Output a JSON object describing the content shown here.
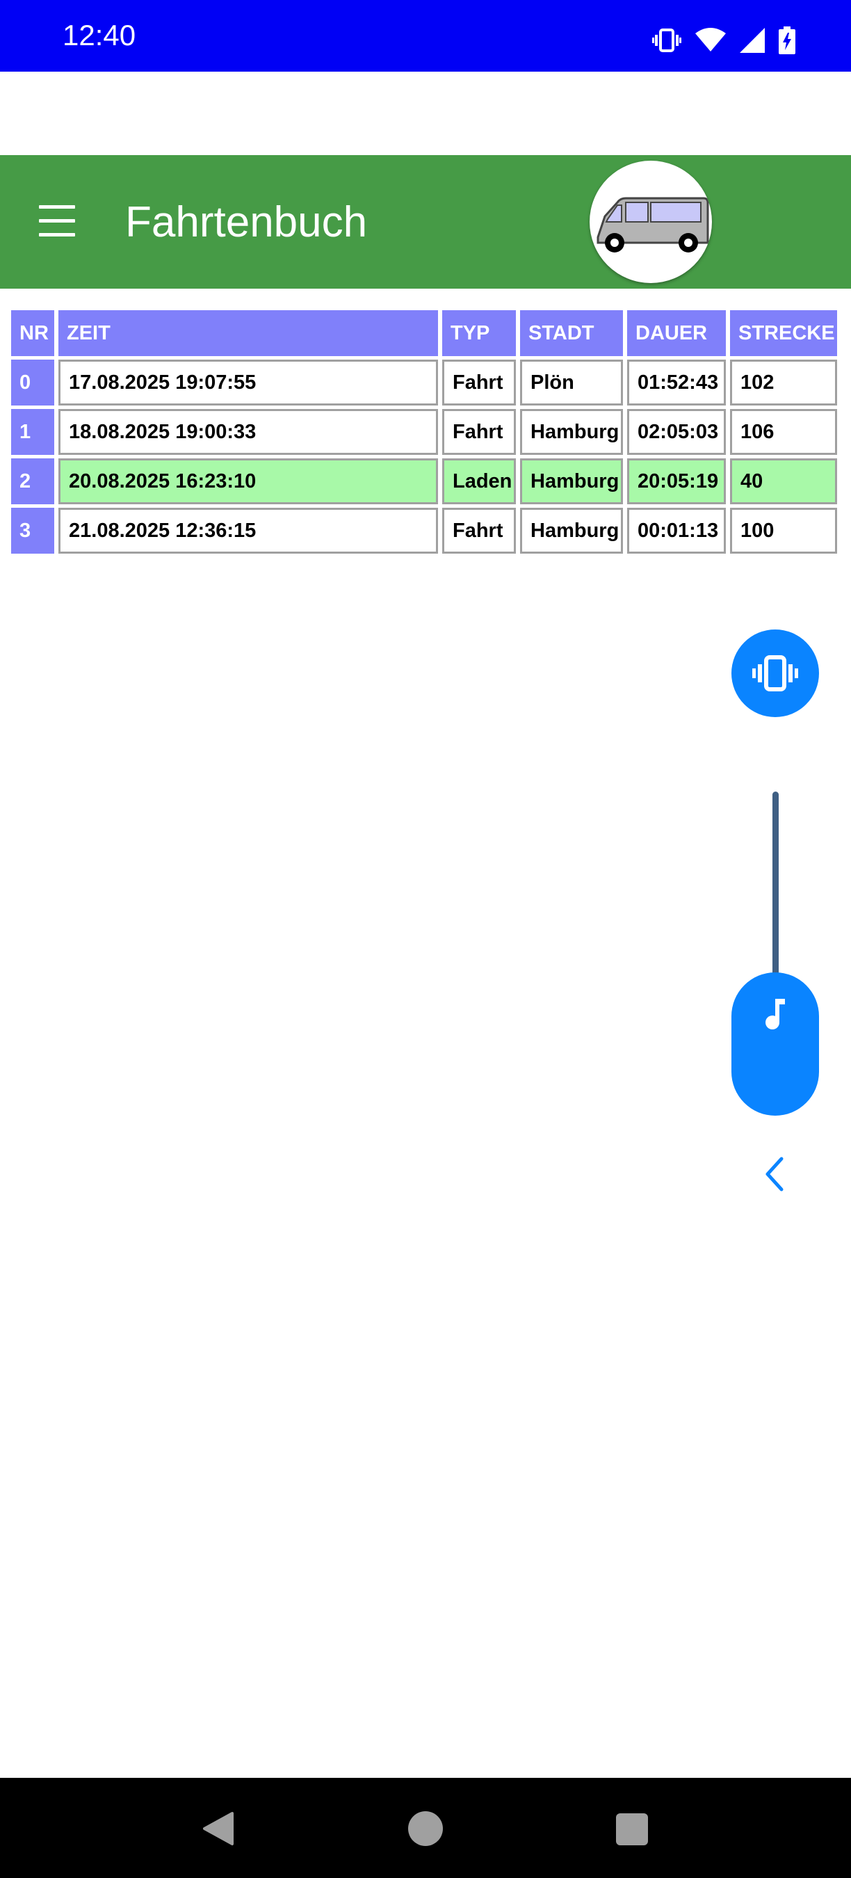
{
  "status_bar": {
    "time": "12:40",
    "icons": [
      "vibrate-icon",
      "wifi-icon",
      "signal-icon",
      "battery-charging-icon"
    ]
  },
  "app_bar": {
    "title": "Fahrtenbuch",
    "menu_icon": "hamburger-menu-icon",
    "logo_icon": "van-icon",
    "color": "#469b46"
  },
  "table": {
    "headers": {
      "nr": "NR",
      "zeit": "ZEIT",
      "typ": "TYP",
      "stadt": "STADT",
      "dauer": "DAUER",
      "strecke": "STRECKE"
    },
    "header_color": "#8080fa",
    "highlight_color": "#a8f9a8",
    "rows": [
      {
        "nr": "0",
        "zeit": "17.08.2025 19:07:55",
        "typ": "Fahrt",
        "stadt": "Plön",
        "dauer": "01:52:43",
        "strecke": "102"
      },
      {
        "nr": "1",
        "zeit": "18.08.2025 19:00:33",
        "typ": "Fahrt",
        "stadt": "Hamburg",
        "dauer": "02:05:03",
        "strecke": "106"
      },
      {
        "nr": "2",
        "zeit": "20.08.2025 16:23:10",
        "typ": "Laden",
        "stadt": "Hamburg",
        "dauer": "20:05:19",
        "strecke": "40"
      },
      {
        "nr": "3",
        "zeit": "21.08.2025 12:36:15",
        "typ": "Fahrt",
        "stadt": "Hamburg",
        "dauer": "00:01:13",
        "strecke": "100"
      }
    ]
  },
  "volume_panel": {
    "ringer_mode_icon": "vibrate-icon",
    "stream_icon": "music-note-icon",
    "collapse_icon": "chevron-left-icon",
    "accent_color": "#0a84ff"
  },
  "nav_bar": {
    "icons": [
      "back-icon",
      "home-icon",
      "recents-icon"
    ]
  }
}
